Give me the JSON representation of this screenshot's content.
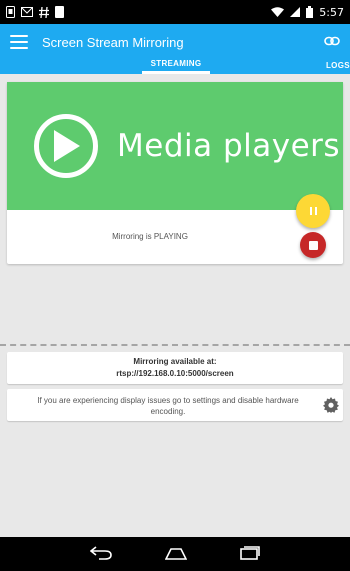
{
  "status_bar": {
    "time": "5:57",
    "left_icons": [
      "sim-icon",
      "gmail-icon",
      "hash-icon",
      "storage-icon"
    ],
    "right_icons": [
      "wifi-icon",
      "signal-icon",
      "battery-icon"
    ]
  },
  "app_bar": {
    "title": "Screen Stream Mirroring",
    "color": "#1eaaf1",
    "tabs": [
      {
        "label": "STREAMING",
        "selected": true
      },
      {
        "label": "LOGS",
        "selected": false
      }
    ]
  },
  "main_card": {
    "banner_text": "Media players",
    "banner_color": "#5ecb6e",
    "status_text": "Mirroring is PLAYING",
    "pause_color": "#fdd835",
    "stop_color": "#c62828"
  },
  "availability": {
    "label": "Mirroring available at:",
    "url": "rtsp://192.168.0.10:5000/screen"
  },
  "info": {
    "text": "If you are experiencing display issues go to settings and disable hardware encoding."
  }
}
